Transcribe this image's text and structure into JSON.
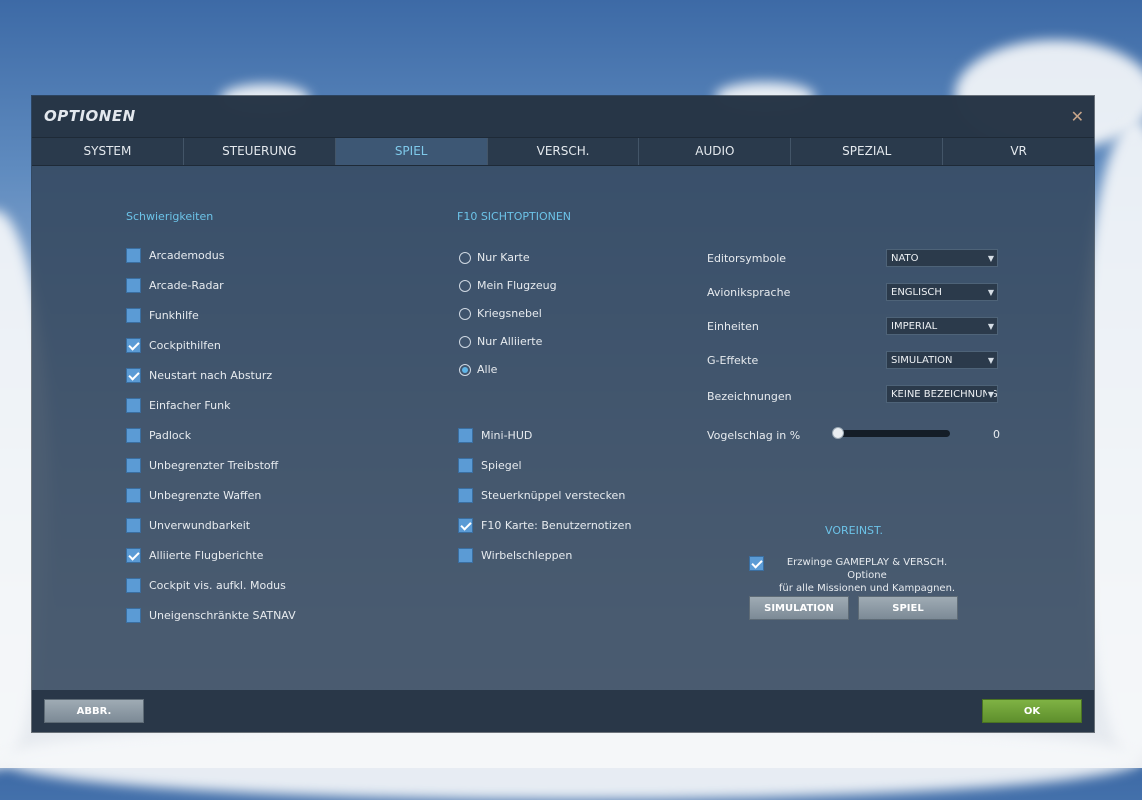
{
  "window": {
    "title": "OPTIONEN"
  },
  "tabs": [
    "SYSTEM",
    "STEUERUNG",
    "SPIEL",
    "VERSCH.",
    "AUDIO",
    "SPEZIAL",
    "VR"
  ],
  "difficulty": {
    "title": "Schwierigkeiten",
    "items": [
      {
        "label": "Arcademodus",
        "checked": false
      },
      {
        "label": "Arcade-Radar",
        "checked": false
      },
      {
        "label": "Funkhilfe",
        "checked": false
      },
      {
        "label": "Cockpithilfen",
        "checked": true
      },
      {
        "label": "Neustart nach Absturz",
        "checked": true
      },
      {
        "label": "Einfacher Funk",
        "checked": false
      },
      {
        "label": "Padlock",
        "checked": false
      },
      {
        "label": "Unbegrenzter Treibstoff",
        "checked": false
      },
      {
        "label": "Unbegrenzte Waffen",
        "checked": false
      },
      {
        "label": "Unverwundbarkeit",
        "checked": false
      },
      {
        "label": "Alliierte Flugberichte",
        "checked": true
      },
      {
        "label": "Cockpit vis. aufkl. Modus",
        "checked": false
      },
      {
        "label": "Uneigenschränkte SATNAV",
        "checked": false
      }
    ]
  },
  "f10": {
    "title": "F10 SICHTOPTIONEN",
    "radios": [
      {
        "label": "Nur Karte",
        "selected": false
      },
      {
        "label": "Mein Flugzeug",
        "selected": false
      },
      {
        "label": "Kriegsnebel",
        "selected": false
      },
      {
        "label": "Nur Alliierte",
        "selected": false
      },
      {
        "label": "Alle",
        "selected": true
      }
    ],
    "checks": [
      {
        "label": "Mini-HUD",
        "checked": false
      },
      {
        "label": "Spiegel",
        "checked": false
      },
      {
        "label": "Steuerknüppel verstecken",
        "checked": false
      },
      {
        "label": "F10 Karte: Benutzernotizen",
        "checked": true
      },
      {
        "label": "Wirbelschleppen",
        "checked": false
      }
    ]
  },
  "settings": [
    {
      "label": "Editorsymbole",
      "value": "NATO"
    },
    {
      "label": "Avioniksprache",
      "value": "ENGLISCH"
    },
    {
      "label": "Einheiten",
      "value": "IMPERIAL"
    },
    {
      "label": "G-Effekte",
      "value": "SIMULATION"
    },
    {
      "label": "Bezeichnungen",
      "value": "KEINE BEZEICHNUNGEN"
    }
  ],
  "birdstrike": {
    "label": "Vogelschlag in %",
    "value": "0",
    "fraction": 0
  },
  "presets": {
    "title": "VOREINST.",
    "force_line1": "Erzwinge GAMEPLAY & VERSCH. Optione",
    "force_line2": "für alle Missionen und Kampagnen.",
    "force_checked": true,
    "sim_label": "SIMULATION",
    "game_label": "SPIEL"
  },
  "footer": {
    "cancel_label": "ABBR.",
    "ok_label": "OK"
  },
  "icons": {
    "close": "close-icon",
    "dropdown": "chevron-down-icon",
    "check": "checkmark-icon"
  },
  "colors": {
    "accent": "#6cc3e8",
    "checkbox": "#5b9bd5",
    "ok": "#6ea23a"
  }
}
